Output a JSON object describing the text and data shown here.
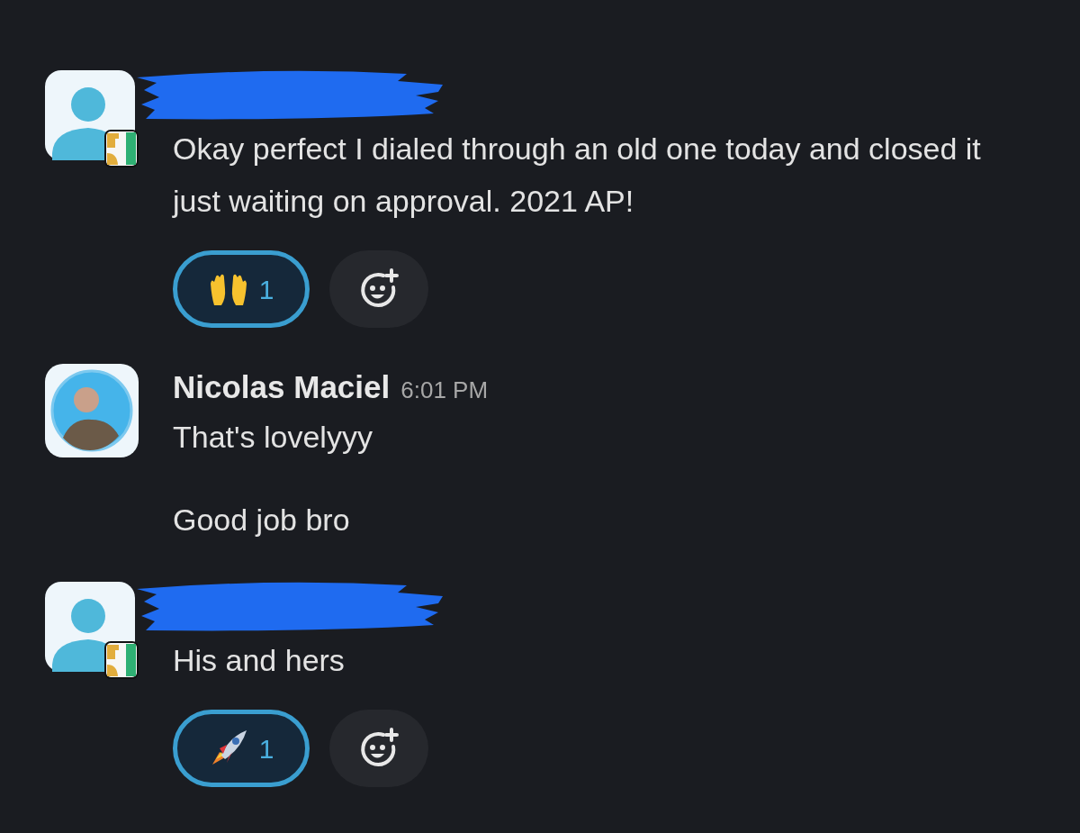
{
  "messages": [
    {
      "kind": "redacted",
      "paragraphs": [
        "Okay perfect I dialed through an old one today and closed it just waiting on approval. 2021 AP!"
      ],
      "reactions": [
        {
          "kind": "raised-hands",
          "count": "1",
          "selected": true
        }
      ]
    },
    {
      "kind": "named",
      "author": "Nicolas Maciel",
      "time": "6:01 PM",
      "paragraphs": [
        "That's lovelyyy",
        "Good job bro"
      ]
    },
    {
      "kind": "redacted",
      "paragraphs": [
        "His and hers"
      ],
      "reactions": [
        {
          "kind": "rocket",
          "count": "1",
          "selected": true
        }
      ]
    }
  ]
}
